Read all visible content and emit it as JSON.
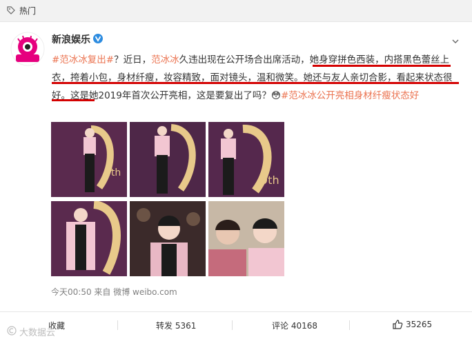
{
  "top": {
    "label": "热门"
  },
  "post": {
    "author": "新浪娱乐",
    "avatar_text": "新浪娱乐",
    "segments": [
      {
        "t": "#范冰冰复出#",
        "c": "link"
      },
      {
        "t": "？近日，",
        "c": ""
      },
      {
        "t": "范冰冰",
        "c": "hl"
      },
      {
        "t": "久违出现在公开场合出席活动，她身穿拼色西装，内搭黑色蕾丝上衣，挎着小包，身材纤瘦，妆容精致，面对镜头，温和微笑。她还与友人亲切合影，看起来状态很好。这是她2019年首次公开亮相，这是要复出了吗？",
        "c": ""
      },
      {
        "t": "😳",
        "c": "emoji"
      },
      {
        "t": "#范冰冰公开亮相身材纤瘦状态好",
        "c": "link"
      }
    ],
    "meta": "今天00:50 来自 微博 weibo.com",
    "photo_text": "9th"
  },
  "actions": {
    "collect": "收藏",
    "repost": "转发 5361",
    "comment": "评论 40168",
    "like": "35265"
  },
  "watermark": "大数据云",
  "colors": {
    "link": "#eb7350",
    "underline": "#d40000"
  }
}
